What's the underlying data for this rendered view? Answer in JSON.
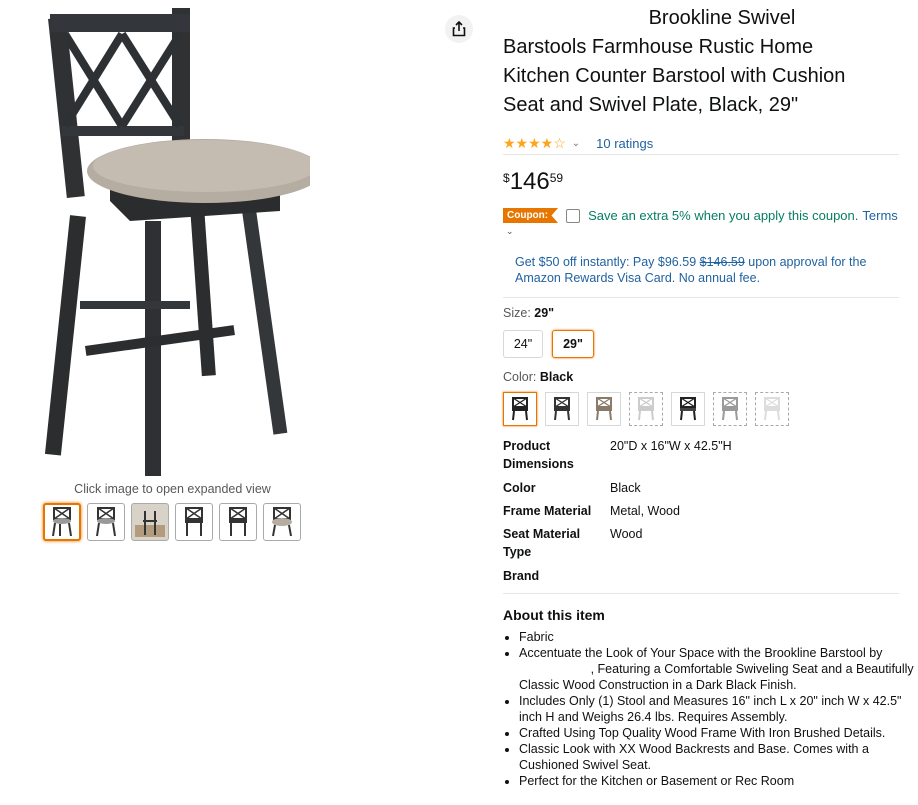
{
  "gallery": {
    "expand_hint": "Click image to open expanded view"
  },
  "product": {
    "title_lines": [
      "Brookline Swivel",
      "Barstools Farmhouse Rustic Home",
      "Kitchen Counter Barstool with Cushion",
      "Seat and Swivel Plate, Black, 29\""
    ],
    "ratings_text": "10 ratings",
    "rating_stars": 4,
    "price_symbol": "$",
    "price_whole": "146",
    "price_fraction": "59"
  },
  "coupon": {
    "badge": "Coupon:",
    "text": "Save an extra 5% when you apply this coupon.",
    "terms": "Terms"
  },
  "visa": {
    "before": "Get $50 off instantly: Pay $96.59",
    "strike": "$146.59",
    "after": "upon approval for the Amazon Rewards Visa Card. No annual fee."
  },
  "size": {
    "label": "Size:",
    "selected": "29\"",
    "options": [
      "24\"",
      "29\""
    ]
  },
  "color": {
    "label": "Color:",
    "selected": "Black"
  },
  "specs": [
    {
      "key": "Product Dimensions",
      "value": "20\"D x 16\"W x 42.5\"H"
    },
    {
      "key": "Color",
      "value": "Black"
    },
    {
      "key": "Frame Material",
      "value": "Metal, Wood"
    },
    {
      "key": "Seat Material Type",
      "value": "Wood"
    },
    {
      "key": "Brand",
      "value": ""
    }
  ],
  "about": {
    "title": "About this item",
    "bullets": [
      "Fabric",
      "Accentuate the Look of Your Space with the Brookline Barstool by",
      ", Featuring a Comfortable Swiveling Seat and a Beautifully Classic Wood Construction in a Dark Black Finish.",
      "Includes Only (1) Stool and Measures 16\" inch L x 20\" inch W x 42.5\" inch H and Weighs 26.4 lbs. Requires Assembly.",
      "Crafted Using Top Quality Wood Frame With Iron Brushed Details.",
      "Classic Look with XX Wood Backrests and Base. Comes with a Cushioned Swivel Seat.",
      "Perfect for the Kitchen or Basement or Rec Room"
    ]
  },
  "colors": {
    "accent": "#e77600",
    "link": "#2162a1",
    "deal_green": "#067d62",
    "star": "#ffa41c"
  }
}
